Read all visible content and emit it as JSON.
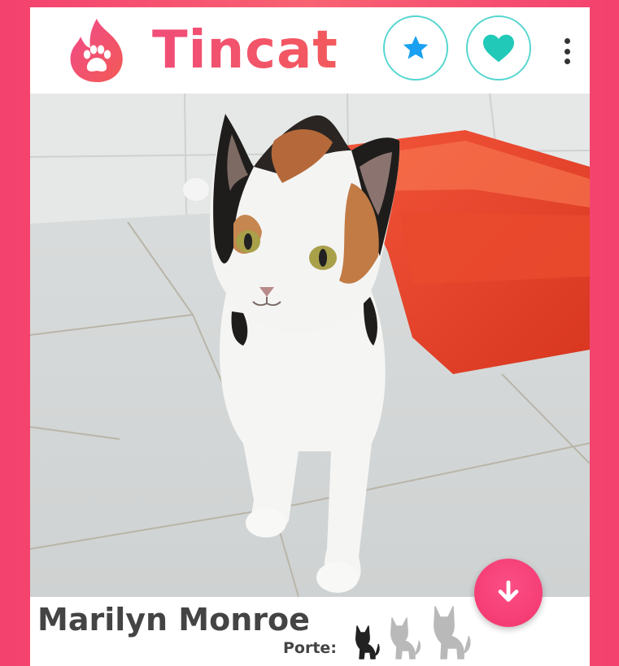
{
  "app": {
    "brand_name": "Tincat",
    "brand_color": "#f0506a",
    "logo_icon": "flame-paw-icon"
  },
  "header": {
    "star_button_icon": "star-icon",
    "heart_button_icon": "heart-icon",
    "menu_icon": "more-vertical-icon",
    "accent_blue": "#1aa0f0",
    "accent_teal": "#21c9b9"
  },
  "profile": {
    "name": "Marilyn Monroe",
    "size_label": "Porte:",
    "size_levels_total": 3,
    "size_level_selected": 1,
    "size_icon": "cat-silhouette-icon"
  },
  "actions": {
    "down_button_icon": "arrow-down-icon"
  }
}
